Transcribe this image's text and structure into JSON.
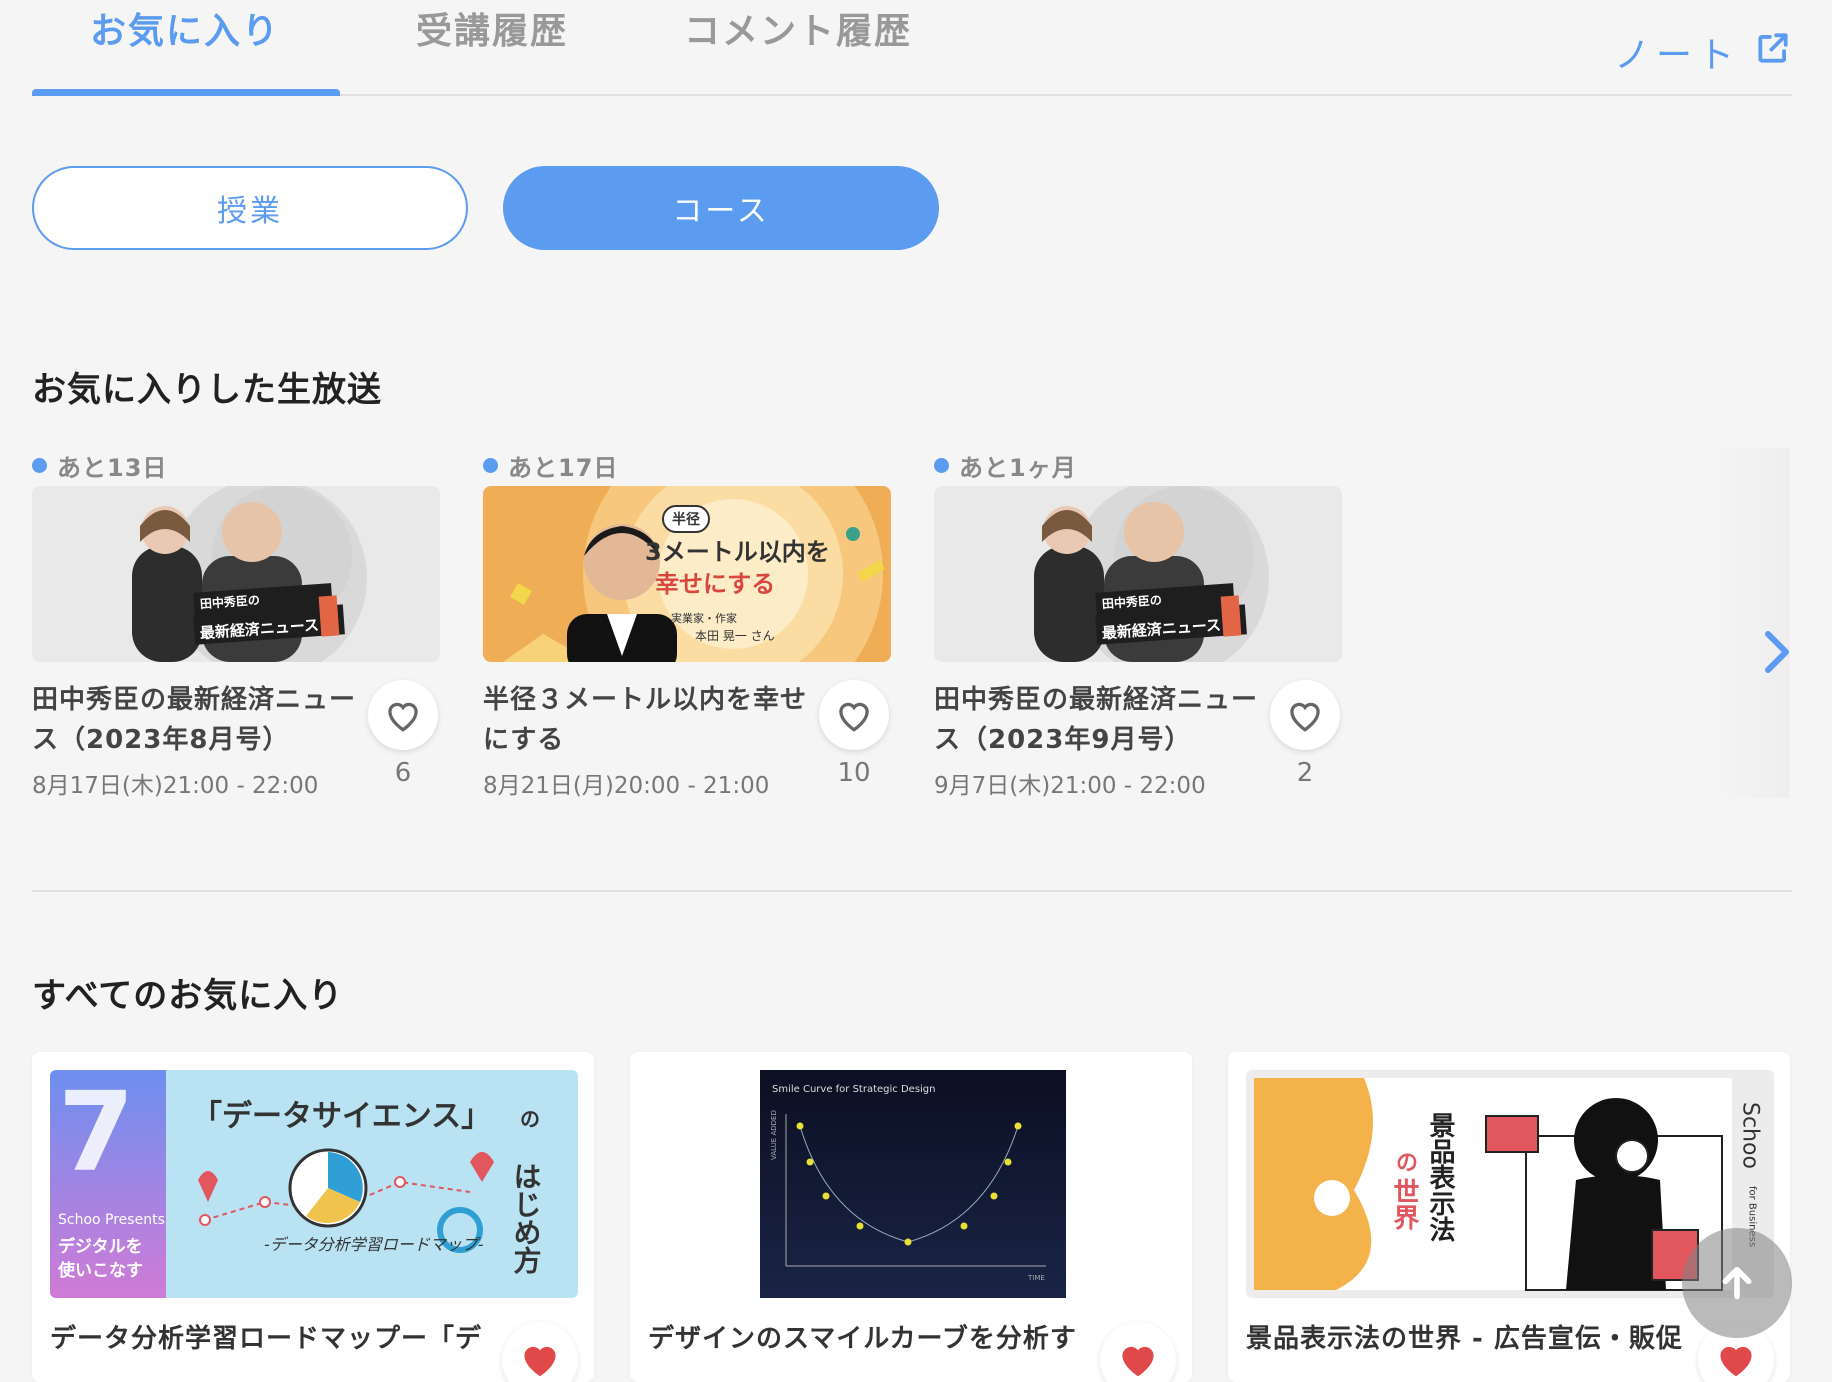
{
  "tabs": {
    "favorites": "お気に入り",
    "history": "受講履歴",
    "comments": "コメント履歴",
    "note": "ノート"
  },
  "segments": {
    "classes": "授業",
    "courses": "コース"
  },
  "live_section": {
    "title": "お気に入りした生放送",
    "items": [
      {
        "countdown": "あと13日",
        "title_line1": "田中秀臣の最新経済ニュー",
        "title_line2": "ス（2023年8月号）",
        "date": "8月17日(木)21:00 - 22:00",
        "count": "6",
        "thumb_caption1": "田中秀臣の",
        "thumb_caption2": "最新経済ニュース"
      },
      {
        "countdown": "あと17日",
        "title_line1": "半径３メートル以内を幸せ",
        "title_line2": "にする",
        "date": "8月21日(月)20:00 - 21:00",
        "count": "10",
        "thumb_badge": "半径",
        "thumb_line1": "3メートル以内を",
        "thumb_line2": "幸せにする",
        "thumb_role": "実業家・作家",
        "thumb_name": "本田 晃一 さん"
      },
      {
        "countdown": "あと1ヶ月",
        "title_line1": "田中秀臣の最新経済ニュー",
        "title_line2": "ス（2023年9月号）",
        "date": "9月7日(木)21:00 - 22:00",
        "count": "2",
        "thumb_caption1": "田中秀臣の",
        "thumb_caption2": "最新経済ニュース"
      }
    ]
  },
  "all_section": {
    "title": "すべてのお気に入り",
    "items": [
      {
        "title": "データ分析学習ロードマップー「デ",
        "thumb_heading": "「データサイエンス」",
        "thumb_no": "の",
        "thumb_vertical": "はじめ方",
        "thumb_sub": "-データ分析学習ロードマップ-",
        "thumb_brand": "Schoo Presents",
        "thumb_tag1": "デジタルを",
        "thumb_tag2": "使いこなす",
        "thumb_num": "7"
      },
      {
        "title": "デザインのスマイルカーブを分析す",
        "thumb_heading": "Smile Curve for Strategic Design",
        "thumb_x": "TIME",
        "thumb_y": "VALUE ADDED"
      },
      {
        "title": "景品表示法の世界 - 広告宣伝・販促",
        "thumb_no": "の",
        "thumb_world": "世界",
        "thumb_vertical": "景品表示法",
        "thumb_brand": "Schoo",
        "thumb_brand_sub": "for Business"
      }
    ]
  },
  "colors": {
    "accent": "#5b9bf0",
    "heart": "#e0484a"
  }
}
